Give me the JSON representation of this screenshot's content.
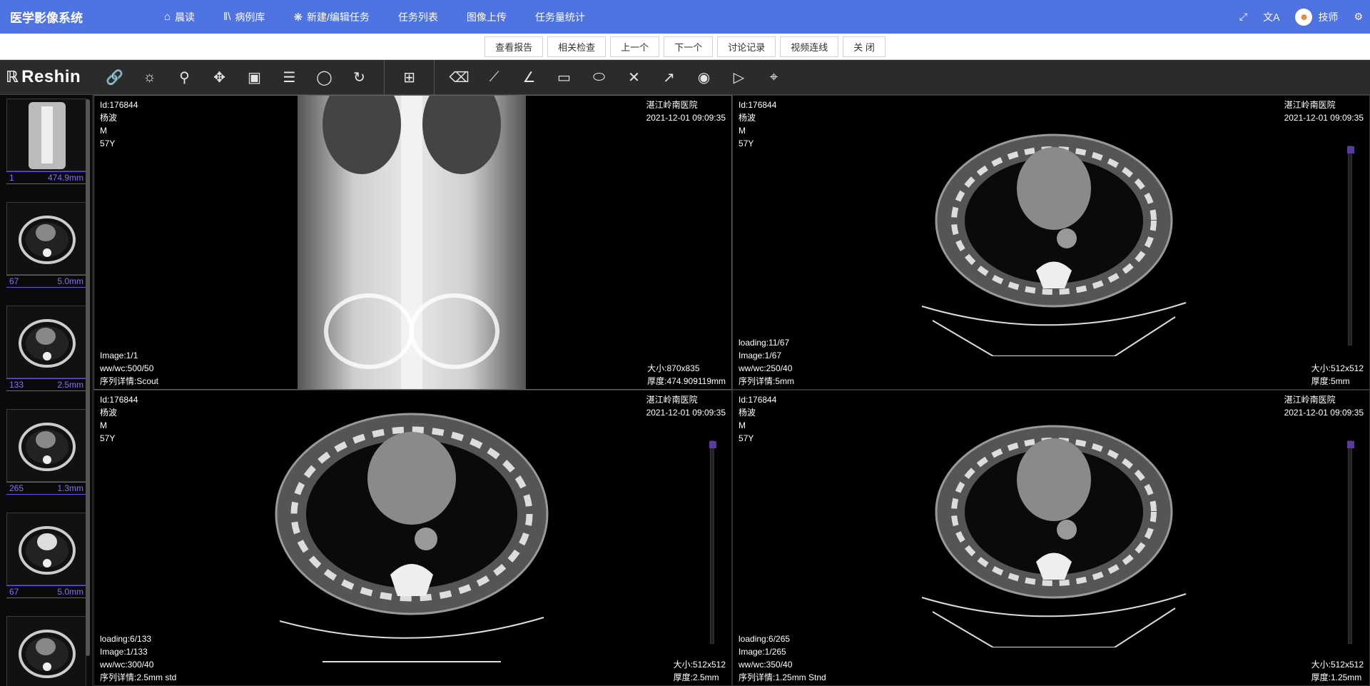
{
  "app": {
    "title": "医学影像系统"
  },
  "nav": [
    {
      "label": "晨读",
      "icon": "home-icon",
      "glyph": "⌂"
    },
    {
      "label": "病例库",
      "icon": "library-icon",
      "glyph": "‖\\"
    },
    {
      "label": "新建/编辑任务",
      "icon": "edit-task-icon",
      "glyph": "❋"
    },
    {
      "label": "任务列表",
      "icon": "",
      "glyph": ""
    },
    {
      "label": "图像上传",
      "icon": "",
      "glyph": ""
    },
    {
      "label": "任务量统计",
      "icon": "",
      "glyph": ""
    }
  ],
  "user": {
    "name": "技师"
  },
  "actions": [
    "查看报告",
    "相关检查",
    "上一个",
    "下一个",
    "讨论记录",
    "视频连线",
    "关 闭"
  ],
  "logo": {
    "text": "Reshin"
  },
  "tools_left": [
    {
      "name": "link-icon",
      "glyph": "🔗"
    },
    {
      "name": "window-level-icon",
      "glyph": "☼"
    },
    {
      "name": "zoom-icon",
      "glyph": "⚲"
    },
    {
      "name": "pan-icon",
      "glyph": "✥"
    },
    {
      "name": "image-icon",
      "glyph": "▣"
    },
    {
      "name": "list-settings-icon",
      "glyph": "☰"
    },
    {
      "name": "magnify-icon",
      "glyph": "◯"
    },
    {
      "name": "rotate-icon",
      "glyph": "↻"
    }
  ],
  "tools_mid": [
    {
      "name": "layout-grid-icon",
      "glyph": "⊞"
    }
  ],
  "tools_right": [
    {
      "name": "eraser-icon",
      "glyph": "⌫"
    },
    {
      "name": "line-icon",
      "glyph": "⟋"
    },
    {
      "name": "angle-icon",
      "glyph": "∠"
    },
    {
      "name": "rectangle-icon",
      "glyph": "▭"
    },
    {
      "name": "ellipse-icon",
      "glyph": "⬭"
    },
    {
      "name": "cross-icon",
      "glyph": "✕"
    },
    {
      "name": "arrow-icon",
      "glyph": "↗"
    },
    {
      "name": "record-icon",
      "glyph": "◉"
    },
    {
      "name": "play-icon",
      "glyph": "▷"
    },
    {
      "name": "crosshair-icon",
      "glyph": "⌖"
    }
  ],
  "thumbnails": [
    {
      "left": "1",
      "right": "474.9mm"
    },
    {
      "left": "67",
      "right": "5.0mm"
    },
    {
      "left": "133",
      "right": "2.5mm"
    },
    {
      "left": "265",
      "right": "1.3mm"
    },
    {
      "left": "67",
      "right": "5.0mm"
    },
    {
      "left": "",
      "right": ""
    }
  ],
  "viewports": [
    {
      "tl": [
        "Id:176844",
        "杨波",
        "M",
        "57Y"
      ],
      "tr": [
        "湛江岭南医院",
        "2021-12-01 09:09:35"
      ],
      "bl": [
        "Image:1/1",
        "ww/wc:500/50",
        "序列详情:Scout"
      ],
      "br": [
        "大小:870x835",
        "厚度:474.909119mm"
      ]
    },
    {
      "tl": [
        "Id:176844",
        "杨波",
        "M",
        "57Y"
      ],
      "tr": [
        "湛江岭南医院",
        "2021-12-01 09:09:35"
      ],
      "bl": [
        "loading:11/67",
        "Image:1/67",
        "ww/wc:250/40",
        "序列详情:5mm"
      ],
      "br": [
        "大小:512x512",
        "厚度:5mm"
      ]
    },
    {
      "tl": [
        "Id:176844",
        "杨波",
        "M",
        "57Y"
      ],
      "tr": [
        "湛江岭南医院",
        "2021-12-01 09:09:35"
      ],
      "bl": [
        "loading:6/133",
        "Image:1/133",
        "ww/wc:300/40",
        "序列详情:2.5mm std"
      ],
      "br": [
        "大小:512x512",
        "厚度:2.5mm"
      ]
    },
    {
      "tl": [
        "Id:176844",
        "杨波",
        "M",
        "57Y"
      ],
      "tr": [
        "湛江岭南医院",
        "2021-12-01 09:09:35"
      ],
      "bl": [
        "loading:6/265",
        "Image:1/265",
        "ww/wc:350/40",
        "序列详情:1.25mm Stnd"
      ],
      "br": [
        "大小:512x512",
        "厚度:1.25mm"
      ]
    }
  ]
}
